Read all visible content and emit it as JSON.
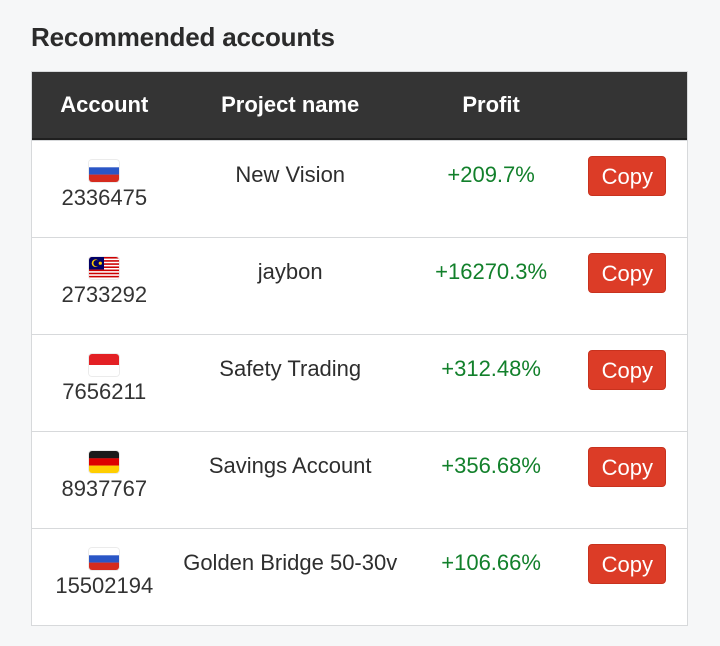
{
  "section": {
    "title": "Recommended accounts"
  },
  "table": {
    "headers": {
      "account": "Account",
      "project": "Project name",
      "profit": "Profit"
    },
    "rows": [
      {
        "flag": "russia-flag-icon",
        "account": "2336475",
        "project": "New Vision",
        "profit": "+209.7%",
        "action": "Copy"
      },
      {
        "flag": "malaysia-flag-icon",
        "account": "2733292",
        "project": "jaybon",
        "profit": "+16270.3%",
        "action": "Copy"
      },
      {
        "flag": "indonesia-flag-icon",
        "account": "7656211",
        "project": "Safety Trading",
        "profit": "+312.48%",
        "action": "Copy"
      },
      {
        "flag": "germany-flag-icon",
        "account": "8937767",
        "project": "Savings Account",
        "profit": "+356.68%",
        "action": "Copy"
      },
      {
        "flag": "russia-flag-icon",
        "account": "15502194",
        "project": "Golden Bridge 50-30v",
        "profit": "+106.66%",
        "action": "Copy"
      }
    ]
  },
  "colors": {
    "header_bg": "#343434",
    "profit": "#12802b",
    "button": "#dc3c27"
  }
}
